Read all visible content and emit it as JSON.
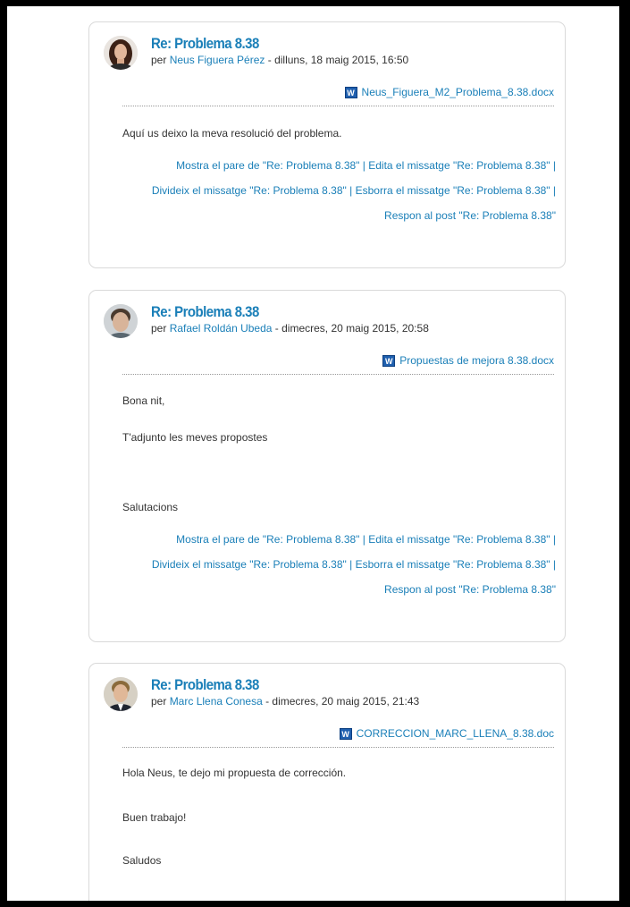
{
  "posts": [
    {
      "subject": "Re: Problema 8.38",
      "by_prefix": "per",
      "author": "Neus Figuera Pérez",
      "date": " - dilluns, 18 maig 2015, 16:50",
      "avatar_icon": "avatar-woman",
      "attachment": "Neus_Figuera_M2_Problema_8.38.docx",
      "message": [
        "Aquí us deixo la meva resolució del problema."
      ],
      "commands": {
        "show_parent": "Mostra el pare de \"Re: Problema 8.38\"",
        "edit": "Edita el missatge \"Re: Problema 8.38\"",
        "split": "Divideix el missatge \"Re: Problema 8.38\"",
        "delete": "Esborra el missatge \"Re: Problema 8.38\"",
        "reply": "Respon al post \"Re: Problema 8.38\""
      }
    },
    {
      "subject": "Re: Problema 8.38",
      "by_prefix": "per",
      "author": "Rafael Roldán Ubeda",
      "date": " - dimecres, 20 maig 2015, 20:58",
      "avatar_icon": "avatar-man",
      "attachment": "Propuestas de mejora 8.38.docx",
      "message": [
        "Bona nit,",
        "T'adjunto les meves propostes",
        "Salutacions"
      ],
      "commands": {
        "show_parent": "Mostra el pare de \"Re: Problema 8.38\"",
        "edit": "Edita el missatge \"Re: Problema 8.38\"",
        "split": "Divideix el missatge \"Re: Problema 8.38\"",
        "delete": "Esborra el missatge \"Re: Problema 8.38\"",
        "reply": "Respon al post \"Re: Problema 8.38\""
      }
    },
    {
      "subject": "Re: Problema 8.38",
      "by_prefix": "per",
      "author": "Marc Llena Conesa",
      "date": " - dimecres, 20 maig 2015, 21:43",
      "avatar_icon": "avatar-man-suit",
      "attachment": "CORRECCION_MARC_LLENA_8.38.doc",
      "message": [
        "Hola Neus, te dejo mi propuesta de corrección.",
        "Buen trabajo!",
        "Saludos"
      ]
    }
  ],
  "separator": " | ",
  "attachment_icon": "word-document-icon",
  "colors": {
    "link": "#1a7fb8",
    "text": "#333333",
    "border": "#d9d9d9"
  }
}
